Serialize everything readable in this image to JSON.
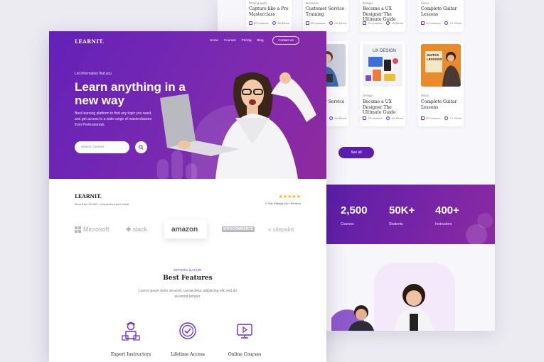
{
  "back": {
    "top_cards": [
      {
        "category": "Photography",
        "title": "Capture like a Pro Masterclass",
        "lessons": "60 Lessons",
        "duration": "6h 30min"
      },
      {
        "category": "Business",
        "title": "Customer Service Training",
        "lessons": "35 Lessons",
        "duration": "4h 30min"
      },
      {
        "category": "Design",
        "title": "Become a UX Designer The Ultimate Guide",
        "lessons": "75 Lessons",
        "duration": "9h 30min"
      },
      {
        "category": "Music",
        "title": "Complete Guitar Lessons",
        "lessons": "90 Lessons",
        "duration": "7h 15min"
      }
    ],
    "mid_cards": [
      {
        "category": "Business",
        "title": "Customer Service Training",
        "lessons": "35 Lessons",
        "duration": "4h 30min"
      },
      {
        "category": "Design",
        "title": "Become a UX Designer The Ultimate Guide",
        "lessons": "75 Lessons",
        "duration": "9h 30min",
        "thumb_text": "UX DESIGN"
      },
      {
        "category": "Music",
        "title": "Complete Guitar Lessons",
        "lessons": "90 Lessons",
        "duration": "7h 15min",
        "thumb_text": "GUITAR LESSONS"
      }
    ],
    "see_all": "See all",
    "stats": [
      {
        "value": "2,500",
        "label": "Courses"
      },
      {
        "value": "50K+",
        "label": "Students"
      },
      {
        "value": "400+",
        "label": "Instructors"
      }
    ]
  },
  "front": {
    "logo": "LEARNIT.",
    "nav": [
      "Home",
      "Courses",
      "Pricing",
      "Blog"
    ],
    "contact": "Contact us",
    "eyebrow": "Let information find you",
    "headline": "Learn anything in a new way",
    "description": "Best learning platform to find any topic you need, and get access to a wide range of masterclasses from Professionals.",
    "search_placeholder": "Search Courses",
    "brand": "LEARNIT.",
    "brand_sub": "More than 15,000+ companies trust Learnit",
    "stars": "★★★★★",
    "rating_text": "5 Star Ratings (2k+ Review)",
    "partners": [
      "Microsoft",
      "slack",
      "amazon",
      "WOOCOMMERCE",
      "sitepoint"
    ],
    "features_eyebrow": "OFFERS SAFARI",
    "features_title": "Best Features",
    "features_desc": "Lorem ipsum dolor sit amet, consectetur adipiscing elit, sed do eiusmod tempor.",
    "features": [
      "Expert Instructors",
      "Lifetime Access",
      "Online Courses"
    ]
  },
  "colors": {
    "primary": "#6321b8",
    "accent": "#8f2a9e",
    "star": "#f6b01e"
  }
}
